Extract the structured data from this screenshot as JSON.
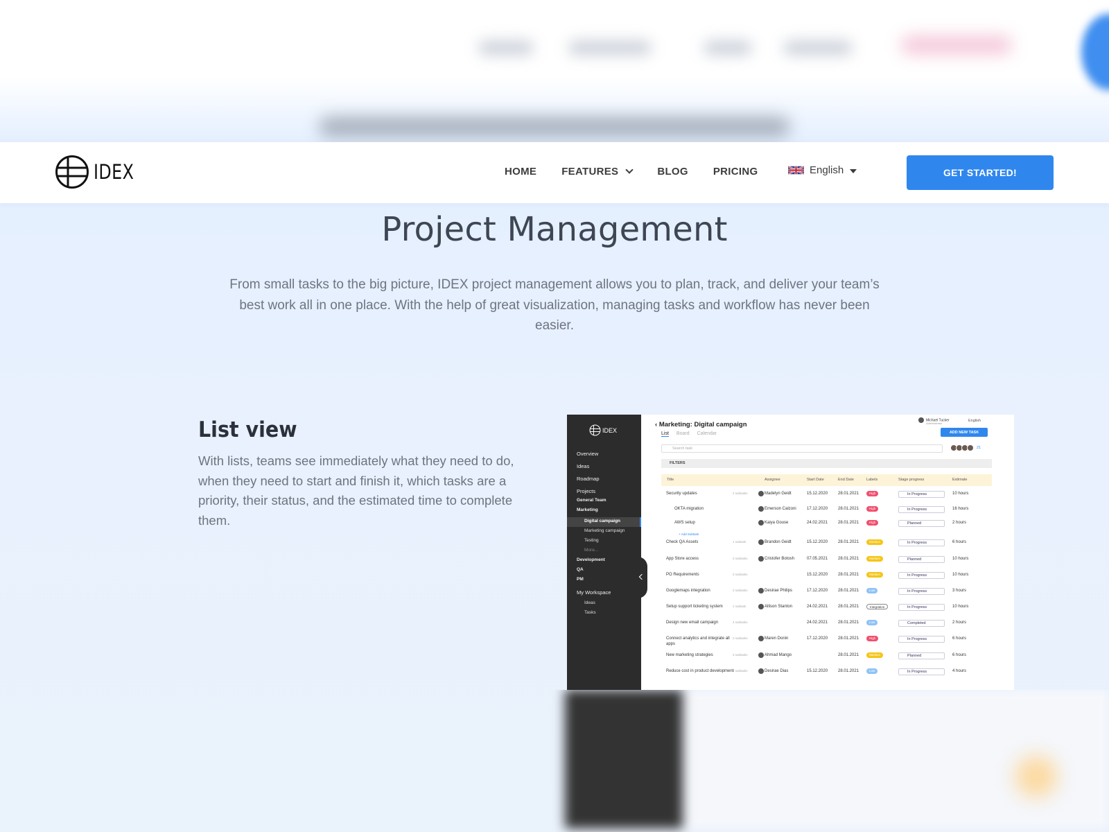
{
  "header": {
    "logo_text": "IDEX",
    "nav": [
      {
        "label": "HOME"
      },
      {
        "label": "FEATURES"
      },
      {
        "label": "BLOG"
      },
      {
        "label": "PRICING"
      }
    ],
    "language": "English",
    "cta_label": "GET STARTED!"
  },
  "hero": {
    "title": "Project Management",
    "text": "From small tasks to the big picture, IDEX project management allows you to plan, track, and deliver your team’s best work all in one place. With the help of great visualization, managing tasks and workflow has never been easier."
  },
  "section": {
    "title": "List view",
    "text": "With lists, teams see immediately what they need to do, when they need to start and finish it, which tasks are a priority, their status, and the estimated time to complete them."
  },
  "app": {
    "logo_text": "IDEX",
    "sidebar": {
      "items": [
        "Overview",
        "Ideas",
        "Roadmap",
        "Projects"
      ],
      "projects": [
        "General Team",
        "Marketing"
      ],
      "marketing_children": [
        "Digital campaign",
        "Marketing campaign",
        "Testing",
        "More..."
      ],
      "more_projects": [
        "Development",
        "QA",
        "PM"
      ],
      "workspace": "My Workspace",
      "workspace_children": [
        "Ideas",
        "Tasks"
      ]
    },
    "title": "Marketing: Digital campaign",
    "tabs": [
      "List",
      "Board",
      "Calendar"
    ],
    "user_name": "Michael Tucker",
    "user_role": "Administrator",
    "lang": "English",
    "add_task": "ADD NEW TASK",
    "search_placeholder": "Search task",
    "member_count": "21",
    "filters": "FILTERS",
    "columns": [
      "Title",
      "Assignee",
      "Start Date",
      "End Date",
      "Labels",
      "Stage progress",
      "Estimate"
    ],
    "add_subtask": "+ Add Subtask",
    "rows": [
      {
        "title": "Security updates",
        "sub": "2 subtasks",
        "who": "Madelyn Geidt",
        "start": "15.12.2020",
        "end": "28.01.2021",
        "label": "High",
        "stage": "In Progress",
        "est": "10 hours"
      },
      {
        "title": "OKTA migration",
        "sub": "",
        "who": "Emerson Calzoni",
        "start": "17.12.2020",
        "end": "28.01.2021",
        "label": "High",
        "stage": "In Progress",
        "est": "16 hours"
      },
      {
        "title": "AWS setup",
        "sub": "",
        "who": "Kaiya Gouse",
        "start": "24.02.2021",
        "end": "28.01.2021",
        "label": "High",
        "stage": "Planned",
        "est": "2 hours"
      },
      {
        "title": "Check QA Assets",
        "sub": "1 subtask",
        "who": "Brandon Geidt",
        "start": "15.12.2020",
        "end": "28.01.2021",
        "label": "Medium",
        "stage": "In Progress",
        "est": "6 hours"
      },
      {
        "title": "App Store access",
        "sub": "3 subtasks",
        "who": "Cristofer Botosh",
        "start": "07.05.2021",
        "end": "28.01.2021",
        "label": "Medium",
        "stage": "Planned",
        "est": "10 hours"
      },
      {
        "title": "PO Requirements",
        "sub": "3 subtasks",
        "who": "",
        "start": "15.12.2020",
        "end": "28.01.2021",
        "label": "Medium",
        "stage": "In Progress",
        "est": "10 hours"
      },
      {
        "title": "Googlemaps integration",
        "sub": "2 subtasks",
        "who": "Desirae Philips",
        "start": "17.12.2020",
        "end": "28.01.2021",
        "label": "Low",
        "stage": "In Progress",
        "est": "3 hours"
      },
      {
        "title": "Setup support ticketing system",
        "sub": "1 subtask",
        "who": "Allison Stanton",
        "start": "24.02.2021",
        "end": "28.01.2021",
        "label": "Integration",
        "stage": "In Progress",
        "est": "10 hours"
      },
      {
        "title": "Design new email campaign",
        "sub": "4 subtasks",
        "who": "",
        "start": "24.02.2021",
        "end": "28.01.2021",
        "label": "Low",
        "stage": "Completed",
        "est": "2 hours"
      },
      {
        "title": "Connect analytics and integrate all apps",
        "sub": "2 subtasks",
        "who": "Maren Donin",
        "start": "17.12.2020",
        "end": "28.01.2021",
        "label": "High",
        "stage": "In Progress",
        "est": "6 hours"
      },
      {
        "title": "New marketing strategies",
        "sub": "3 subtasks",
        "who": "Ahmad Mango",
        "start": "",
        "end": "28.01.2021",
        "label": "Medium",
        "stage": "Planned",
        "est": "6 hours"
      },
      {
        "title": "Reduce cost in product development",
        "sub": "4 subtasks",
        "who": "Desirae Dias",
        "start": "15.12.2020",
        "end": "28.01.2021",
        "label": "Low",
        "stage": "In Progress",
        "est": "4 hours"
      }
    ]
  },
  "colors": {
    "accent": "#2f87ee",
    "high": "#f0506e",
    "medium": "#f5c518",
    "low": "#8fc3f5",
    "sidebar": "#2c2c2c"
  }
}
